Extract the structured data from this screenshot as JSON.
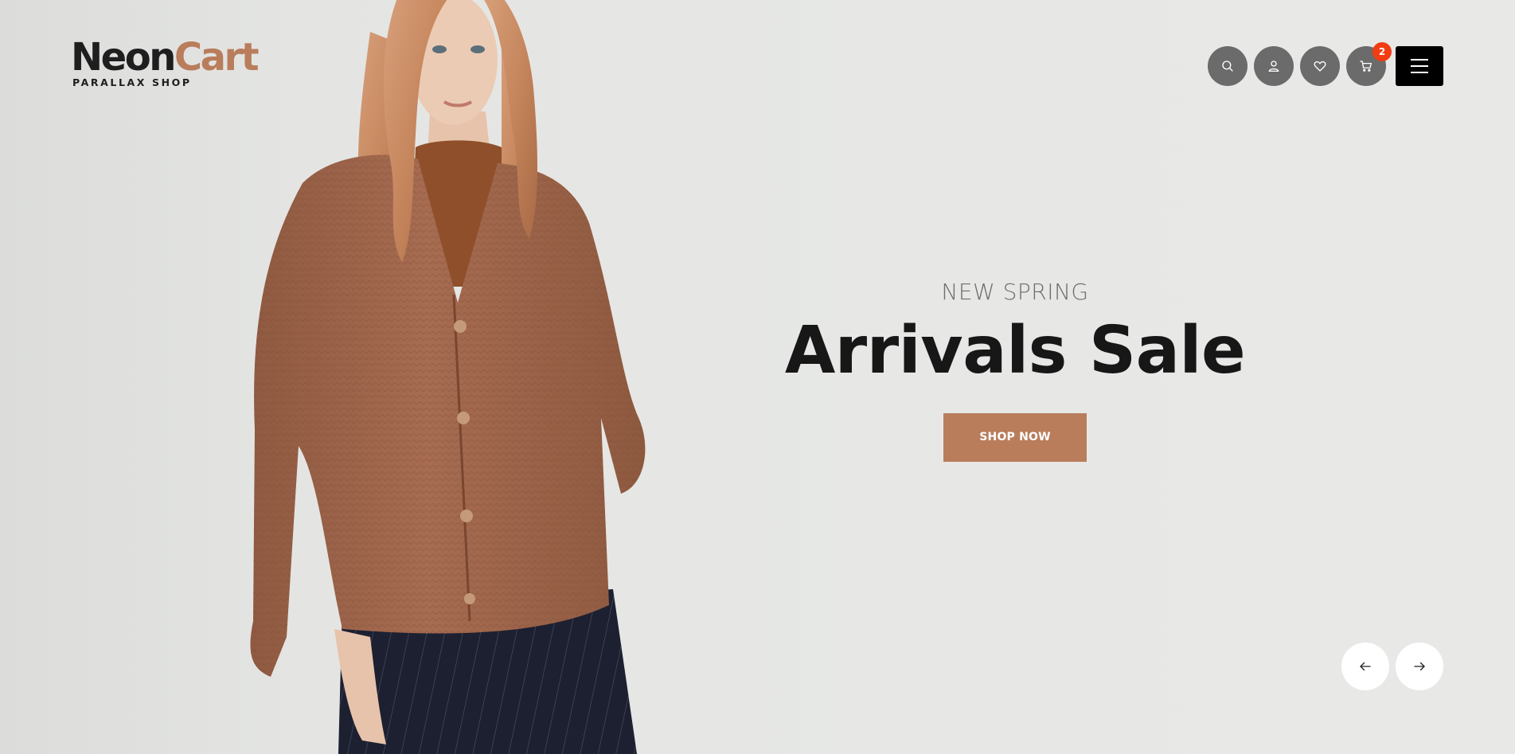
{
  "brand": {
    "name_part1": "Neon",
    "name_part2": "Cart",
    "tagline": "PARALLAX SHOP",
    "accent_color": "#b97d5c"
  },
  "header": {
    "icons": [
      {
        "name": "search-icon"
      },
      {
        "name": "user-icon"
      },
      {
        "name": "heart-icon"
      },
      {
        "name": "cart-icon",
        "badge": "2"
      }
    ],
    "menu_icon": "hamburger-menu-icon"
  },
  "slide": {
    "kicker": "NEW SPRING",
    "title": "Arrivals Sale",
    "button_label": "SHOP NOW",
    "image_alt": "model-wearing-brown-cardigan"
  },
  "slider_nav": {
    "prev_icon": "arrow-left-icon",
    "next_icon": "arrow-right-icon"
  },
  "colors": {
    "background": "#e6e7e5",
    "badge": "#f23c12",
    "icon_bg": "#6b6b6b",
    "menu_bg": "#000000"
  }
}
